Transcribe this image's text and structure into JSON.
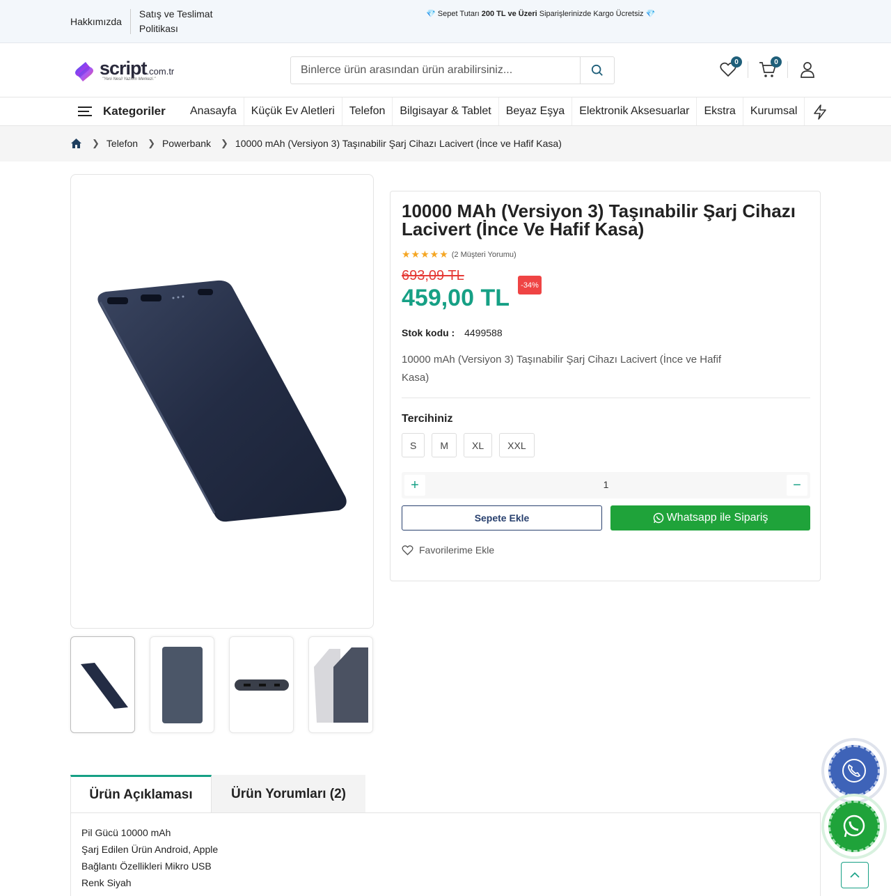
{
  "topbar": {
    "about": "Hakkımızda",
    "policy": "Satış ve Teslimat Politikası",
    "promo_pre": "Sepet Tutarı",
    "promo_bold": "200 TL ve Üzeri",
    "promo_post": "Siparişlerinizde Kargo Ücretsiz"
  },
  "logo": {
    "word": "script",
    "tld": ".com.tr",
    "tagline": "\"Yeni Nesil Yazılım Merkezi.\""
  },
  "search": {
    "placeholder": "Binlerce ürün arasından ürün arabilirsiniz..."
  },
  "header": {
    "wishlist_count": "0",
    "cart_count": "0"
  },
  "nav": {
    "categories_label": "Kategoriler",
    "items": [
      "Anasayfa",
      "Küçük Ev Aletleri",
      "Telefon",
      "Bilgisayar & Tablet",
      "Beyaz Eşya",
      "Elektronik Aksesuarlar",
      "Ekstra",
      "Kurumsal"
    ]
  },
  "breadcrumb": [
    "Telefon",
    "Powerbank",
    "10000 mAh (Versiyon 3) Taşınabilir Şarj Cihazı Lacivert (İnce ve Hafif Kasa)"
  ],
  "product": {
    "title": "10000 MAh (Versiyon 3) Taşınabilir Şarj Cihazı Lacivert (İnce Ve Hafif Kasa)",
    "rating_stars": 5,
    "reviews_text": "(2 Müşteri Yorumu)",
    "old_price": "693,09 TL",
    "new_price": "459,00 TL",
    "discount": "-34%",
    "stock_label": "Stok kodu :",
    "stock_code": "4499588",
    "description": "10000 mAh (Versiyon 3) Taşınabilir Şarj Cihazı Lacivert (İnce ve Hafif Kasa)",
    "option_label": "Tercihiniz",
    "options": [
      "S",
      "M",
      "XL",
      "XXL"
    ],
    "quantity": "1",
    "add_to_cart": "Sepete Ekle",
    "whatsapp_order": "Whatsapp ile Sipariş",
    "add_favorite": "Favorilerime Ekle"
  },
  "tabs": [
    "Ürün Açıklaması",
    "Ürün Yorumları (2)"
  ],
  "specs": [
    "Pil Gücü 10000 mAh",
    "Şarj Edilen Ürün Android, Apple",
    "Bağlantı Özellikleri Mikro USB",
    "Renk Siyah"
  ],
  "colors": {
    "accent": "#16a085",
    "price_red": "#e53935",
    "whatsapp": "#1fa33a",
    "badge": "#1f5f7a",
    "navy": "#28406e"
  }
}
